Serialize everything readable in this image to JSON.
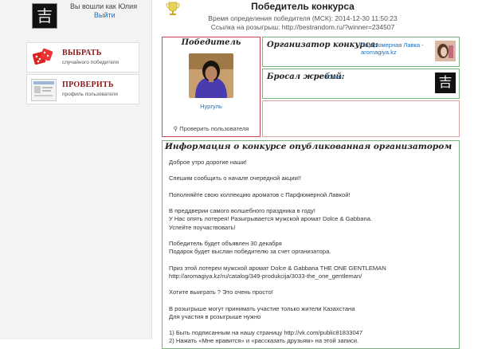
{
  "sidebar": {
    "logged_in_text": "Вы вошли как Юлия",
    "logout_label": "Выйти",
    "avatar_glyph": "吉",
    "buttons": [
      {
        "title": "ВЫБРАТЬ",
        "subtitle": "случайного победителя",
        "icon": "dice-icon"
      },
      {
        "title": "ПРОВЕРИТЬ",
        "subtitle": "профиль пользователя",
        "icon": "profile-check-icon"
      }
    ]
  },
  "header": {
    "title": "Победитель конкурса",
    "time_line": "Время определения победителя (МСК): 2014-12-30 11:50:23",
    "link_line": "Ссылка на розыгрыш: http://bestrandom.ru/?winner=234507"
  },
  "winner": {
    "heading": "Победитель",
    "name": "Нургуль",
    "verify_label": "Проверить пользователя"
  },
  "organizer": {
    "heading": "Организатор конкурса:",
    "name": "Парфюмерная Лавка - aromagiya.kz"
  },
  "thrower": {
    "heading": "Бросал жребий:",
    "name": "Юлия",
    "avatar_glyph": "吉"
  },
  "info": {
    "heading": "Информация о конкурсе опубликованная организатором",
    "lines": [
      "Доброе утро дорогие наши!",
      "",
      "Спешим сообщить о начале очередной акции!!",
      "",
      "Пополняйте свою коллекцию ароматов с Парфюмерной Лавкой!",
      "",
      "В преддверии самого волшебного праздника в году!",
      "У Нас опять лотерея! Разыгрывается мужской аромат Dolce & Gabbana.",
      "Успейте поучаствовать!",
      "",
      "Победитель будет объявлен 30 декабря",
      "Подарок будет выслан победителю за счет организатора.",
      "",
      "Приз этой лотереи мужской аромат Dolce & Gabbana THE ONE GENTLEMAN",
      "http://aromagiya.kz/ru/catalog/349-produkcija/3033-the_one_gentleman/",
      "",
      "Хотите выиграть ? Это очень просто!",
      "",
      "В розыгрыше могут принимать участие только жители Казахстана",
      "Для участия в розыгрыше нужно",
      "",
      "1) Быть подписанным на нашу страницу http://vk.com/public81833047",
      "2) Нажать «Мне нравится» и «рассказать друзьям» на этой записи."
    ]
  },
  "colors": {
    "accent_red": "#8b1a1a",
    "link_blue": "#1a6fc0",
    "box_green": "#7cb27c",
    "box_red": "#c94a4a"
  }
}
